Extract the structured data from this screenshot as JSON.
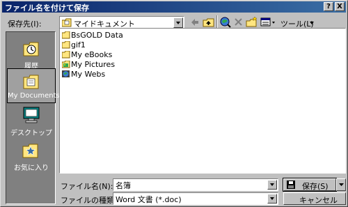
{
  "window": {
    "title": "ファイル名を付けて保存",
    "help_label": "?",
    "close_label": "X"
  },
  "toolbar": {
    "save_in_label": "保存先(I):",
    "location_value": "マイドキュメント",
    "tools_label": "ツール(L)"
  },
  "places": [
    {
      "label": "履歴"
    },
    {
      "label": "My Documents"
    },
    {
      "label": "デスクトップ"
    },
    {
      "label": "お気に入り"
    }
  ],
  "files": [
    {
      "name": "BsGOLD Data",
      "icon": "folder-icon"
    },
    {
      "name": "gif1",
      "icon": "folder-icon"
    },
    {
      "name": "My eBooks",
      "icon": "folder-icon"
    },
    {
      "name": "My Pictures",
      "icon": "pictures-folder-icon"
    },
    {
      "name": "My Webs",
      "icon": "web-folder-icon"
    }
  ],
  "filename": {
    "label": "ファイル名(N):",
    "value": "名簿"
  },
  "filetype": {
    "label": "ファイルの種類(T):",
    "value": "Word 文書 (*.doc)"
  },
  "buttons": {
    "save": "保存(S)",
    "cancel": "キャンセル"
  },
  "colors": {
    "titlebar_start": "#0a246a",
    "titlebar_end": "#3a6ea5",
    "dialog_bg": "#c0c0c0",
    "places_bg": "#808080",
    "folder": "#ffe680"
  }
}
